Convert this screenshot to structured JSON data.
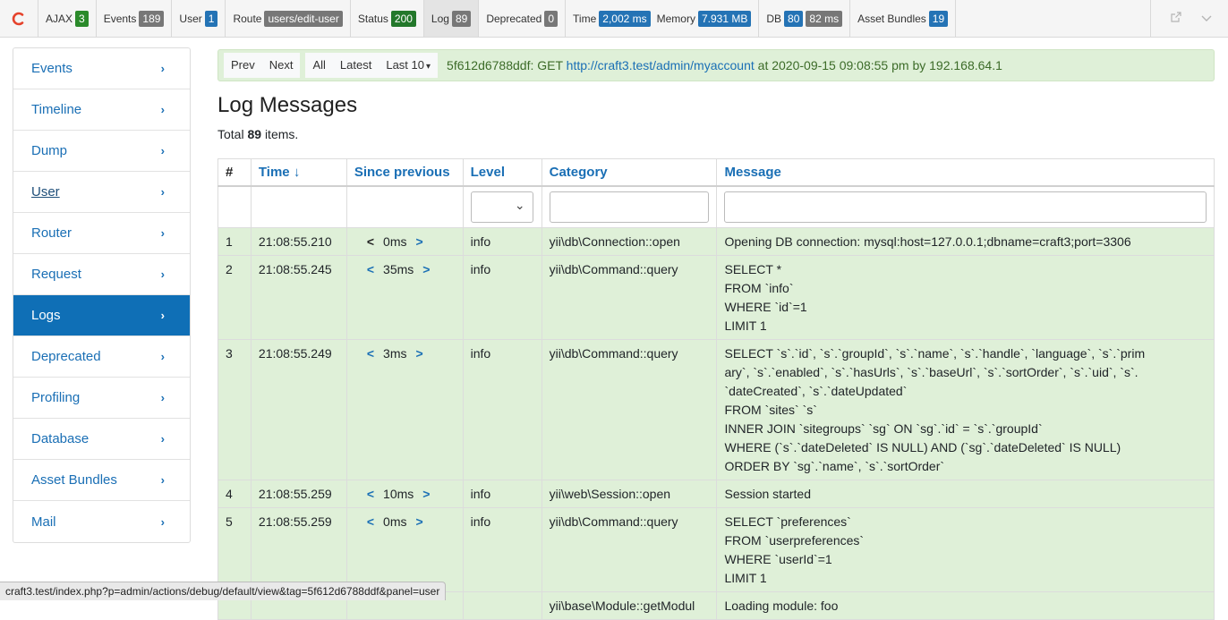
{
  "toolbar": {
    "items": [
      {
        "label": "AJAX",
        "value": "3",
        "color": "#2b8a2b"
      },
      {
        "label": "Events",
        "value": "189",
        "color": "#777777"
      },
      {
        "label": "User",
        "value": "1",
        "color": "#2473b5"
      },
      {
        "label": "Route",
        "value": "users/edit-user",
        "color": "#777777"
      },
      {
        "label": "Status",
        "value": "200",
        "color": "#23782b"
      },
      {
        "label": "Log",
        "value": "89",
        "color": "#777777"
      },
      {
        "label": "Deprecated",
        "value": "0",
        "color": "#777777"
      },
      {
        "label": "Time",
        "value": "2,002 ms",
        "color": "#2473b5"
      },
      {
        "label": "Memory",
        "value": "7.931 MB",
        "color": "#2473b5"
      },
      {
        "label": "DB",
        "value": "80",
        "value2": "82 ms",
        "color": "#2473b5"
      },
      {
        "label": "Asset Bundles",
        "value": "19",
        "color": "#2473b5"
      }
    ]
  },
  "sidebar": {
    "items": [
      {
        "label": "Events"
      },
      {
        "label": "Timeline"
      },
      {
        "label": "Dump"
      },
      {
        "label": "User"
      },
      {
        "label": "Router"
      },
      {
        "label": "Request"
      },
      {
        "label": "Logs"
      },
      {
        "label": "Deprecated"
      },
      {
        "label": "Profiling"
      },
      {
        "label": "Database"
      },
      {
        "label": "Asset Bundles"
      },
      {
        "label": "Mail"
      }
    ],
    "active_color": "#0f6fb6"
  },
  "navbar": {
    "prev": "Prev",
    "next": "Next",
    "all": "All",
    "latest": "Latest",
    "last10": "Last 10",
    "info_prefix": "5f612d6788ddf: GET",
    "url": "http://craft3.test/admin/myaccount",
    "info_suffix": "at 2020-09-15 09:08:55 pm by 192.168.64.1"
  },
  "page": {
    "title": "Log Messages",
    "total_prefix": "Total",
    "total_count": "89",
    "total_suffix": "items."
  },
  "table": {
    "headers": {
      "num": "#",
      "time": "Time ↓",
      "since": "Since previous",
      "level": "Level",
      "category": "Category",
      "message": "Message"
    },
    "rows": [
      {
        "num": "1",
        "time": "21:08:55.210",
        "since": "0ms",
        "level": "info",
        "category": "yii\\db\\Connection::open",
        "message": [
          "Opening DB connection: mysql:host=127.0.0.1;dbname=craft3;port=3306"
        ]
      },
      {
        "num": "2",
        "time": "21:08:55.245",
        "since": "35ms",
        "level": "info",
        "category": "yii\\db\\Command::query",
        "message": [
          "SELECT *",
          "FROM `info`",
          "WHERE `id`=1",
          "LIMIT 1"
        ]
      },
      {
        "num": "3",
        "time": "21:08:55.249",
        "since": "3ms",
        "level": "info",
        "category": "yii\\db\\Command::query",
        "message": [
          "SELECT `s`.`id`, `s`.`groupId`, `s`.`name`, `s`.`handle`, `language`, `s`.`prim",
          "ary`, `s`.`enabled`, `s`.`hasUrls`, `s`.`baseUrl`, `s`.`sortOrder`, `s`.`uid`, `s`.",
          "`dateCreated`, `s`.`dateUpdated`",
          "FROM `sites` `s`",
          "INNER JOIN `sitegroups` `sg` ON `sg`.`id` = `s`.`groupId`",
          "WHERE (`s`.`dateDeleted` IS NULL) AND (`sg`.`dateDeleted` IS NULL)",
          "ORDER BY `sg`.`name`, `s`.`sortOrder`"
        ]
      },
      {
        "num": "4",
        "time": "21:08:55.259",
        "since": "10ms",
        "level": "info",
        "category": "yii\\web\\Session::open",
        "message": [
          "Session started"
        ]
      },
      {
        "num": "5",
        "time": "21:08:55.259",
        "since": "0ms",
        "level": "info",
        "category": "yii\\db\\Command::query",
        "message": [
          "SELECT `preferences`",
          "FROM `userpreferences`",
          "WHERE `userId`=1",
          "LIMIT 1"
        ]
      },
      {
        "num": "",
        "time": "",
        "since": "",
        "level": "",
        "category": "yii\\base\\Module::getModul",
        "message": [
          "Loading module: foo"
        ]
      }
    ]
  },
  "status_url": "craft3.test/index.php?p=admin/actions/debug/default/view&tag=5f612d6788ddf&panel=user"
}
